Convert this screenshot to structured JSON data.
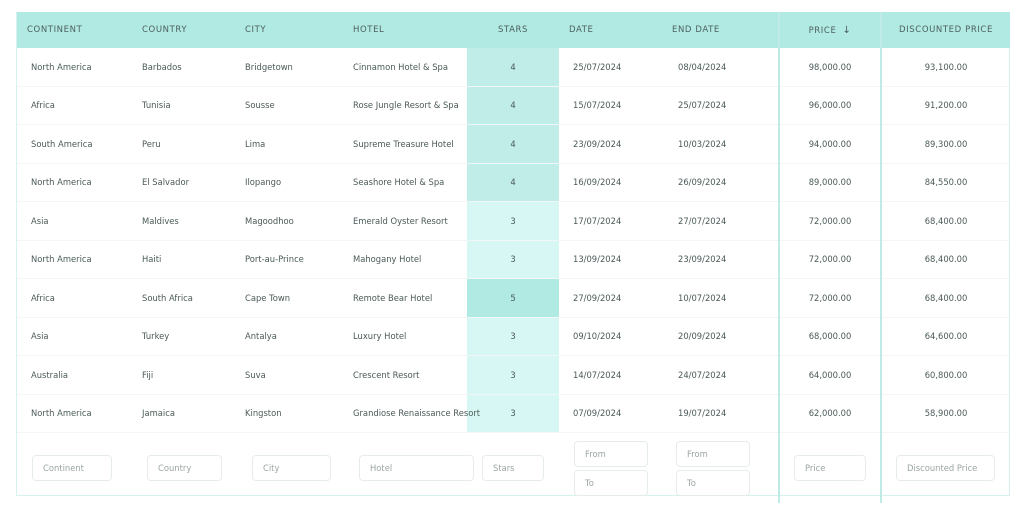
{
  "columns": [
    {
      "key": "continent",
      "label": "CONTINENT"
    },
    {
      "key": "country",
      "label": "COUNTRY"
    },
    {
      "key": "city",
      "label": "CITY"
    },
    {
      "key": "hotel",
      "label": "HOTEL"
    },
    {
      "key": "stars",
      "label": "STARS"
    },
    {
      "key": "date",
      "label": "DATE"
    },
    {
      "key": "end_date",
      "label": "END DATE"
    },
    {
      "key": "price",
      "label": "PRICE",
      "sort": "descending",
      "sort_icon": "↓"
    },
    {
      "key": "discounted_price",
      "label": "DISCOUNTED PRICE"
    }
  ],
  "rows": [
    {
      "continent": "North America",
      "country": "Barbados",
      "city": "Bridgetown",
      "hotel": "Cinnamon Hotel & Spa",
      "stars": "4",
      "date": "25/07/2024",
      "end_date": "08/04/2024",
      "price": "98,000.00",
      "discounted_price": "93,100.00"
    },
    {
      "continent": "Africa",
      "country": "Tunisia",
      "city": "Sousse",
      "hotel": "Rose Jungle Resort & Spa",
      "stars": "4",
      "date": "15/07/2024",
      "end_date": "25/07/2024",
      "price": "96,000.00",
      "discounted_price": "91,200.00"
    },
    {
      "continent": "South America",
      "country": "Peru",
      "city": "Lima",
      "hotel": "Supreme Treasure Hotel",
      "stars": "4",
      "date": "23/09/2024",
      "end_date": "10/03/2024",
      "price": "94,000.00",
      "discounted_price": "89,300.00"
    },
    {
      "continent": "North America",
      "country": "El Salvador",
      "city": "Ilopango",
      "hotel": "Seashore Hotel & Spa",
      "stars": "4",
      "date": "16/09/2024",
      "end_date": "26/09/2024",
      "price": "89,000.00",
      "discounted_price": "84,550.00"
    },
    {
      "continent": "Asia",
      "country": "Maldives",
      "city": "Magoodhoo",
      "hotel": "Emerald Oyster Resort",
      "stars": "3",
      "date": "17/07/2024",
      "end_date": "27/07/2024",
      "price": "72,000.00",
      "discounted_price": "68,400.00"
    },
    {
      "continent": "North America",
      "country": "Haiti",
      "city": "Port-au-Prince",
      "hotel": "Mahogany Hotel",
      "stars": "3",
      "date": "13/09/2024",
      "end_date": "23/09/2024",
      "price": "72,000.00",
      "discounted_price": "68,400.00"
    },
    {
      "continent": "Africa",
      "country": "South Africa",
      "city": "Cape Town",
      "hotel": "Remote Bear Hotel",
      "stars": "5",
      "date": "27/09/2024",
      "end_date": "10/07/2024",
      "price": "72,000.00",
      "discounted_price": "68,400.00"
    },
    {
      "continent": "Asia",
      "country": "Turkey",
      "city": "Antalya",
      "hotel": "Luxury Hotel",
      "stars": "3",
      "date": "09/10/2024",
      "end_date": "20/09/2024",
      "price": "68,000.00",
      "discounted_price": "64,600.00"
    },
    {
      "continent": "Australia",
      "country": "Fiji",
      "city": "Suva",
      "hotel": "Crescent Resort",
      "stars": "3",
      "date": "14/07/2024",
      "end_date": "24/07/2024",
      "price": "64,000.00",
      "discounted_price": "60,800.00"
    },
    {
      "continent": "North America",
      "country": "Jamaica",
      "city": "Kingston",
      "hotel": "Grandiose Renaissance Resort",
      "stars": "3",
      "date": "07/09/2024",
      "end_date": "19/07/2024",
      "price": "62,000.00",
      "discounted_price": "58,900.00"
    }
  ],
  "filters": {
    "continent": {
      "placeholder": "Continent"
    },
    "country": {
      "placeholder": "Country"
    },
    "city": {
      "placeholder": "City"
    },
    "hotel": {
      "placeholder": "Hotel"
    },
    "stars": {
      "placeholder": "Stars"
    },
    "date": {
      "from_placeholder": "From",
      "to_placeholder": "To"
    },
    "end_date": {
      "from_placeholder": "From",
      "to_placeholder": "To"
    },
    "price": {
      "placeholder": "Price"
    },
    "discounted_price": {
      "placeholder": "Discounted Price"
    }
  },
  "colors": {
    "header_bg": "#b0eae3",
    "stars_3_bg": "#d6f7f3",
    "stars_4_bg": "#c1ede8",
    "stars_5_bg": "#b0eae3",
    "sorted_column_border": "#bfeae6"
  }
}
